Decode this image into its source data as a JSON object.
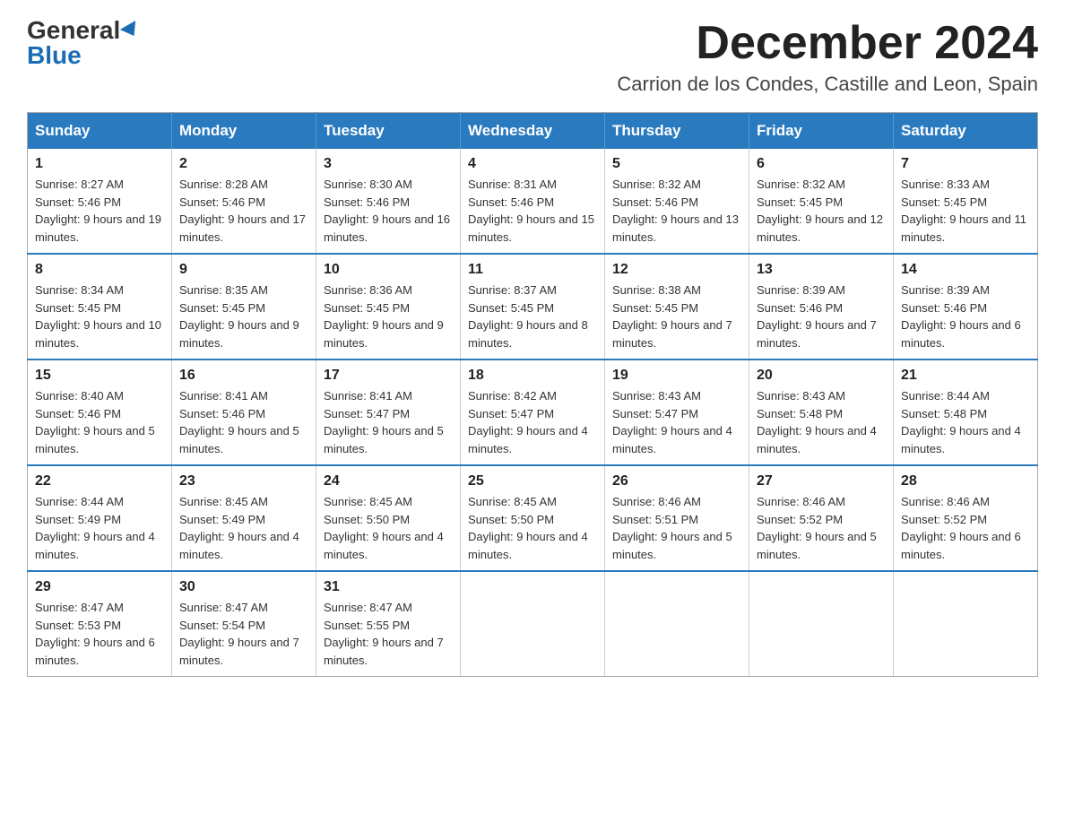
{
  "logo": {
    "general": "General",
    "blue": "Blue"
  },
  "title": {
    "month": "December 2024",
    "location": "Carrion de los Condes, Castille and Leon, Spain"
  },
  "days_of_week": [
    "Sunday",
    "Monday",
    "Tuesday",
    "Wednesday",
    "Thursday",
    "Friday",
    "Saturday"
  ],
  "weeks": [
    [
      {
        "day": "1",
        "sunrise": "8:27 AM",
        "sunset": "5:46 PM",
        "daylight": "9 hours and 19 minutes."
      },
      {
        "day": "2",
        "sunrise": "8:28 AM",
        "sunset": "5:46 PM",
        "daylight": "9 hours and 17 minutes."
      },
      {
        "day": "3",
        "sunrise": "8:30 AM",
        "sunset": "5:46 PM",
        "daylight": "9 hours and 16 minutes."
      },
      {
        "day": "4",
        "sunrise": "8:31 AM",
        "sunset": "5:46 PM",
        "daylight": "9 hours and 15 minutes."
      },
      {
        "day": "5",
        "sunrise": "8:32 AM",
        "sunset": "5:46 PM",
        "daylight": "9 hours and 13 minutes."
      },
      {
        "day": "6",
        "sunrise": "8:32 AM",
        "sunset": "5:45 PM",
        "daylight": "9 hours and 12 minutes."
      },
      {
        "day": "7",
        "sunrise": "8:33 AM",
        "sunset": "5:45 PM",
        "daylight": "9 hours and 11 minutes."
      }
    ],
    [
      {
        "day": "8",
        "sunrise": "8:34 AM",
        "sunset": "5:45 PM",
        "daylight": "9 hours and 10 minutes."
      },
      {
        "day": "9",
        "sunrise": "8:35 AM",
        "sunset": "5:45 PM",
        "daylight": "9 hours and 9 minutes."
      },
      {
        "day": "10",
        "sunrise": "8:36 AM",
        "sunset": "5:45 PM",
        "daylight": "9 hours and 9 minutes."
      },
      {
        "day": "11",
        "sunrise": "8:37 AM",
        "sunset": "5:45 PM",
        "daylight": "9 hours and 8 minutes."
      },
      {
        "day": "12",
        "sunrise": "8:38 AM",
        "sunset": "5:45 PM",
        "daylight": "9 hours and 7 minutes."
      },
      {
        "day": "13",
        "sunrise": "8:39 AM",
        "sunset": "5:46 PM",
        "daylight": "9 hours and 7 minutes."
      },
      {
        "day": "14",
        "sunrise": "8:39 AM",
        "sunset": "5:46 PM",
        "daylight": "9 hours and 6 minutes."
      }
    ],
    [
      {
        "day": "15",
        "sunrise": "8:40 AM",
        "sunset": "5:46 PM",
        "daylight": "9 hours and 5 minutes."
      },
      {
        "day": "16",
        "sunrise": "8:41 AM",
        "sunset": "5:46 PM",
        "daylight": "9 hours and 5 minutes."
      },
      {
        "day": "17",
        "sunrise": "8:41 AM",
        "sunset": "5:47 PM",
        "daylight": "9 hours and 5 minutes."
      },
      {
        "day": "18",
        "sunrise": "8:42 AM",
        "sunset": "5:47 PM",
        "daylight": "9 hours and 4 minutes."
      },
      {
        "day": "19",
        "sunrise": "8:43 AM",
        "sunset": "5:47 PM",
        "daylight": "9 hours and 4 minutes."
      },
      {
        "day": "20",
        "sunrise": "8:43 AM",
        "sunset": "5:48 PM",
        "daylight": "9 hours and 4 minutes."
      },
      {
        "day": "21",
        "sunrise": "8:44 AM",
        "sunset": "5:48 PM",
        "daylight": "9 hours and 4 minutes."
      }
    ],
    [
      {
        "day": "22",
        "sunrise": "8:44 AM",
        "sunset": "5:49 PM",
        "daylight": "9 hours and 4 minutes."
      },
      {
        "day": "23",
        "sunrise": "8:45 AM",
        "sunset": "5:49 PM",
        "daylight": "9 hours and 4 minutes."
      },
      {
        "day": "24",
        "sunrise": "8:45 AM",
        "sunset": "5:50 PM",
        "daylight": "9 hours and 4 minutes."
      },
      {
        "day": "25",
        "sunrise": "8:45 AM",
        "sunset": "5:50 PM",
        "daylight": "9 hours and 4 minutes."
      },
      {
        "day": "26",
        "sunrise": "8:46 AM",
        "sunset": "5:51 PM",
        "daylight": "9 hours and 5 minutes."
      },
      {
        "day": "27",
        "sunrise": "8:46 AM",
        "sunset": "5:52 PM",
        "daylight": "9 hours and 5 minutes."
      },
      {
        "day": "28",
        "sunrise": "8:46 AM",
        "sunset": "5:52 PM",
        "daylight": "9 hours and 6 minutes."
      }
    ],
    [
      {
        "day": "29",
        "sunrise": "8:47 AM",
        "sunset": "5:53 PM",
        "daylight": "9 hours and 6 minutes."
      },
      {
        "day": "30",
        "sunrise": "8:47 AM",
        "sunset": "5:54 PM",
        "daylight": "9 hours and 7 minutes."
      },
      {
        "day": "31",
        "sunrise": "8:47 AM",
        "sunset": "5:55 PM",
        "daylight": "9 hours and 7 minutes."
      },
      null,
      null,
      null,
      null
    ]
  ]
}
